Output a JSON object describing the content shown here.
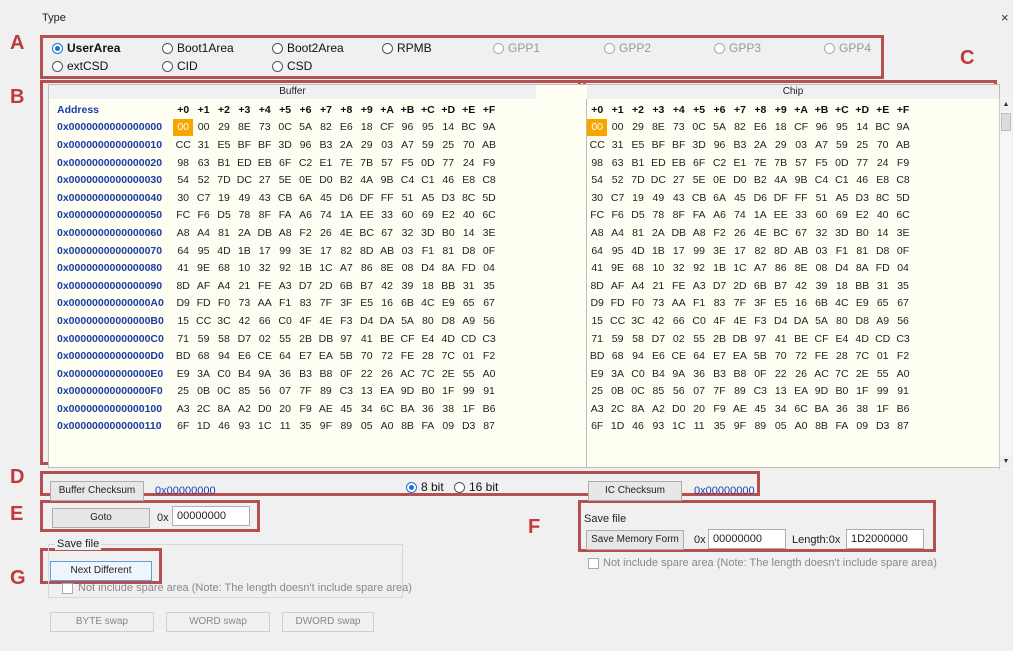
{
  "window": {
    "title": "Type",
    "close_label": "×"
  },
  "letters": {
    "a": "A",
    "b": "B",
    "c": "C",
    "d": "D",
    "e": "E",
    "f": "F",
    "g": "G"
  },
  "partition_radios": [
    {
      "label": "UserArea",
      "selected": true,
      "enabled": true
    },
    {
      "label": "Boot1Area",
      "selected": false,
      "enabled": true
    },
    {
      "label": "Boot2Area",
      "selected": false,
      "enabled": true
    },
    {
      "label": "RPMB",
      "selected": false,
      "enabled": true
    },
    {
      "label": "GPP1",
      "selected": false,
      "enabled": false
    },
    {
      "label": "GPP2",
      "selected": false,
      "enabled": false
    },
    {
      "label": "GPP3",
      "selected": false,
      "enabled": false
    },
    {
      "label": "GPP4",
      "selected": false,
      "enabled": false
    },
    {
      "label": "extCSD",
      "selected": false,
      "enabled": true
    },
    {
      "label": "CID",
      "selected": false,
      "enabled": true
    },
    {
      "label": "CSD",
      "selected": false,
      "enabled": true
    }
  ],
  "grid": {
    "buffer_label": "Buffer",
    "chip_label": "Chip",
    "address_header": "Address",
    "col_headers": [
      "+0",
      "+1",
      "+2",
      "+3",
      "+4",
      "+5",
      "+6",
      "+7",
      "+8",
      "+9",
      "+A",
      "+B",
      "+C",
      "+D",
      "+E",
      "+F"
    ],
    "highlight_text_color": "#ffffff",
    "highlight_color": "#f7a600",
    "rows": [
      {
        "addr": "0x0000000000000000",
        "bytes": [
          "00",
          "00",
          "29",
          "8E",
          "73",
          "0C",
          "5A",
          "82",
          "E6",
          "18",
          "CF",
          "96",
          "95",
          "14",
          "BC",
          "9A"
        ]
      },
      {
        "addr": "0x0000000000000010",
        "bytes": [
          "CC",
          "31",
          "E5",
          "BF",
          "BF",
          "3D",
          "96",
          "B3",
          "2A",
          "29",
          "03",
          "A7",
          "59",
          "25",
          "70",
          "AB"
        ]
      },
      {
        "addr": "0x0000000000000020",
        "bytes": [
          "98",
          "63",
          "B1",
          "ED",
          "EB",
          "6F",
          "C2",
          "E1",
          "7E",
          "7B",
          "57",
          "F5",
          "0D",
          "77",
          "24",
          "F9"
        ]
      },
      {
        "addr": "0x0000000000000030",
        "bytes": [
          "54",
          "52",
          "7D",
          "DC",
          "27",
          "5E",
          "0E",
          "D0",
          "B2",
          "4A",
          "9B",
          "C4",
          "C1",
          "46",
          "E8",
          "C8"
        ]
      },
      {
        "addr": "0x0000000000000040",
        "bytes": [
          "30",
          "C7",
          "19",
          "49",
          "43",
          "CB",
          "6A",
          "45",
          "D6",
          "DF",
          "FF",
          "51",
          "A5",
          "D3",
          "8C",
          "5D"
        ]
      },
      {
        "addr": "0x0000000000000050",
        "bytes": [
          "FC",
          "F6",
          "D5",
          "78",
          "8F",
          "FA",
          "A6",
          "74",
          "1A",
          "EE",
          "33",
          "60",
          "69",
          "E2",
          "40",
          "6C"
        ]
      },
      {
        "addr": "0x0000000000000060",
        "bytes": [
          "A8",
          "A4",
          "81",
          "2A",
          "DB",
          "A8",
          "F2",
          "26",
          "4E",
          "BC",
          "67",
          "32",
          "3D",
          "B0",
          "14",
          "3E"
        ]
      },
      {
        "addr": "0x0000000000000070",
        "bytes": [
          "64",
          "95",
          "4D",
          "1B",
          "17",
          "99",
          "3E",
          "17",
          "82",
          "8D",
          "AB",
          "03",
          "F1",
          "81",
          "D8",
          "0F"
        ]
      },
      {
        "addr": "0x0000000000000080",
        "bytes": [
          "41",
          "9E",
          "68",
          "10",
          "32",
          "92",
          "1B",
          "1C",
          "A7",
          "86",
          "8E",
          "08",
          "D4",
          "8A",
          "FD",
          "04"
        ]
      },
      {
        "addr": "0x0000000000000090",
        "bytes": [
          "8D",
          "AF",
          "A4",
          "21",
          "FE",
          "A3",
          "D7",
          "2D",
          "6B",
          "B7",
          "42",
          "39",
          "18",
          "BB",
          "31",
          "35"
        ]
      },
      {
        "addr": "0x00000000000000A0",
        "bytes": [
          "D9",
          "FD",
          "F0",
          "73",
          "AA",
          "F1",
          "83",
          "7F",
          "3F",
          "E5",
          "16",
          "6B",
          "4C",
          "E9",
          "65",
          "67"
        ]
      },
      {
        "addr": "0x00000000000000B0",
        "bytes": [
          "15",
          "CC",
          "3C",
          "42",
          "66",
          "C0",
          "4F",
          "4E",
          "F3",
          "D4",
          "DA",
          "5A",
          "80",
          "D8",
          "A9",
          "56"
        ]
      },
      {
        "addr": "0x00000000000000C0",
        "bytes": [
          "71",
          "59",
          "58",
          "D7",
          "02",
          "55",
          "2B",
          "DB",
          "97",
          "41",
          "BE",
          "CF",
          "E4",
          "4D",
          "CD",
          "C3"
        ]
      },
      {
        "addr": "0x00000000000000D0",
        "bytes": [
          "BD",
          "68",
          "94",
          "E6",
          "CE",
          "64",
          "E7",
          "EA",
          "5B",
          "70",
          "72",
          "FE",
          "28",
          "7C",
          "01",
          "F2"
        ]
      },
      {
        "addr": "0x00000000000000E0",
        "bytes": [
          "E9",
          "3A",
          "C0",
          "B4",
          "9A",
          "36",
          "B3",
          "B8",
          "0F",
          "22",
          "26",
          "AC",
          "7C",
          "2E",
          "55",
          "A0"
        ]
      },
      {
        "addr": "0x00000000000000F0",
        "bytes": [
          "25",
          "0B",
          "0C",
          "85",
          "56",
          "07",
          "7F",
          "89",
          "C3",
          "13",
          "EA",
          "9D",
          "B0",
          "1F",
          "99",
          "91"
        ]
      },
      {
        "addr": "0x0000000000000100",
        "bytes": [
          "A3",
          "2C",
          "8A",
          "A2",
          "D0",
          "20",
          "F9",
          "AE",
          "45",
          "34",
          "6C",
          "BA",
          "36",
          "38",
          "1F",
          "B6"
        ]
      },
      {
        "addr": "0x0000000000000110",
        "bytes": [
          "6F",
          "1D",
          "46",
          "93",
          "1C",
          "11",
          "35",
          "9F",
          "89",
          "05",
          "A0",
          "8B",
          "FA",
          "09",
          "D3",
          "87"
        ]
      }
    ]
  },
  "checksum": {
    "buffer_button": "Buffer Checksum",
    "buffer_value": "0x00000000",
    "bit8_label": "8 bit",
    "bit16_label": "16 bit",
    "ic_button": "IC Checksum",
    "ic_value": "0x00000000"
  },
  "goto": {
    "button": "Goto",
    "prefix": "0x",
    "value": "00000000"
  },
  "save_left": {
    "group_label": "Save file",
    "next_different": "Next Different",
    "note": "Not include spare area (Note: The length doesn't include spare area)"
  },
  "swap": {
    "byte": "BYTE swap",
    "word": "WORD swap",
    "dword": "DWORD swap"
  },
  "save_right": {
    "group_label": "Save file",
    "button": "Save Memory Form",
    "prefix": "0x",
    "offset": "00000000",
    "length_label": "Length:0x",
    "length": "1D2000000",
    "note": "Not include spare area (Note: The length doesn't include spare area)"
  }
}
